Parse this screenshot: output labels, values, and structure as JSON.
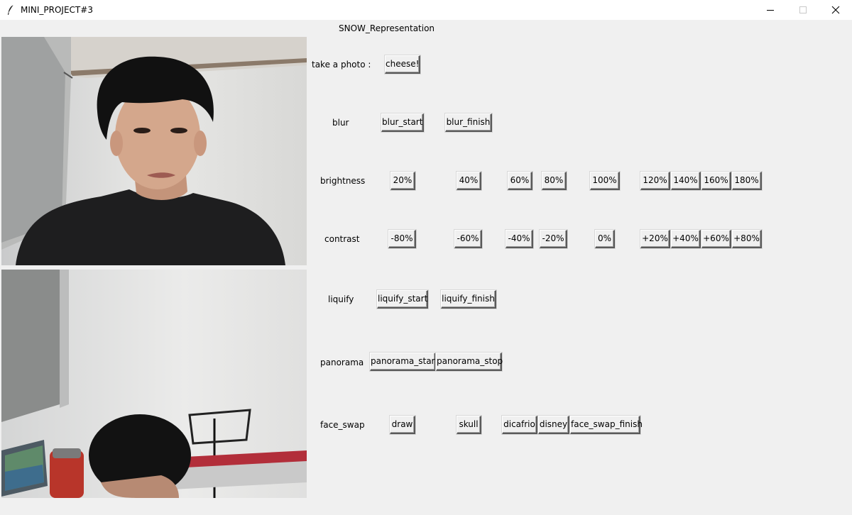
{
  "window": {
    "title": "MINI_PROJECT#3",
    "heading": "SNOW_Representation"
  },
  "rows": {
    "photo": {
      "label": "take a photo :",
      "buttons": [
        "cheese!"
      ]
    },
    "blur": {
      "label": "blur",
      "buttons": [
        "blur_start",
        "blur_finish"
      ]
    },
    "brightness": {
      "label": "brightness",
      "buttons": [
        "20%",
        "40%",
        "60%",
        "80%",
        "100%",
        "120%",
        "140%",
        "160%",
        "180%"
      ]
    },
    "contrast": {
      "label": "contrast",
      "buttons": [
        "-80%",
        "-60%",
        "-40%",
        "-20%",
        "0%",
        "+20%",
        "+40%",
        "+60%",
        "+80%"
      ]
    },
    "liquify": {
      "label": "liquify",
      "buttons": [
        "liquify_start",
        "liquify_finish"
      ]
    },
    "panorama": {
      "label": "panorama",
      "buttons": [
        "panorama_start",
        "panorama_stop"
      ]
    },
    "face_swap": {
      "label": "face_swap",
      "buttons": [
        "draw",
        "skull",
        "dicafrio",
        "disney",
        "face_swap_finish"
      ]
    }
  },
  "colors": {
    "window_bg": "#f0f0f0",
    "titlebar_bg": "#ffffff"
  },
  "icons": {
    "app": "feather-icon",
    "minimize": "minimize-icon",
    "maximize": "maximize-icon",
    "close": "close-icon"
  }
}
